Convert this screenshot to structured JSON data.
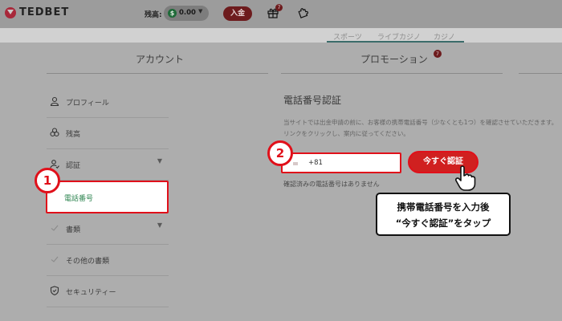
{
  "header": {
    "logo": "TEDBET",
    "balance_label": "残高:",
    "balance_currency_icon": "$",
    "balance_value": "0.00",
    "deposit_label": "入金",
    "gift_badge": "7"
  },
  "subnav": {
    "items": [
      "スポーツ",
      "ライブカジノ",
      "カジノ"
    ]
  },
  "tabs": {
    "account": "アカウント",
    "promotion": "プロモーション",
    "promotion_badge": "7"
  },
  "sidebar": {
    "items": [
      {
        "label": "プロフィール",
        "icon": "user-icon"
      },
      {
        "label": "残高",
        "icon": "coins-icon"
      },
      {
        "label": "認証",
        "icon": "verify-user-icon",
        "expandable": true
      },
      {
        "label": "電話番号",
        "icon": "",
        "active": true
      },
      {
        "label": "書類",
        "icon": "check-icon",
        "expandable": true
      },
      {
        "label": "その他の書類",
        "icon": "check-icon"
      },
      {
        "label": "セキュリティー",
        "icon": "shield-icon"
      }
    ]
  },
  "main": {
    "title": "電話番号認証",
    "description": "当サイトでは出金申請の前に、お客様の携帯電話番号（少なくとも1つ）を確認させていただきます。リンクをクリックし、案内に従ってください。",
    "country_code": "+81",
    "verify_button": "今すぐ認証",
    "no_numbers_text": "確認済みの電話番号はありません"
  },
  "annotations": {
    "step1": "1",
    "step2": "2",
    "callout_line1": "携帯電話番号を入力後",
    "callout_line2": "“今すぐ認証”をタップ"
  },
  "colors": {
    "highlight": "#e0101a",
    "brand": "#6d1b1d",
    "active_text": "#2e8450"
  }
}
